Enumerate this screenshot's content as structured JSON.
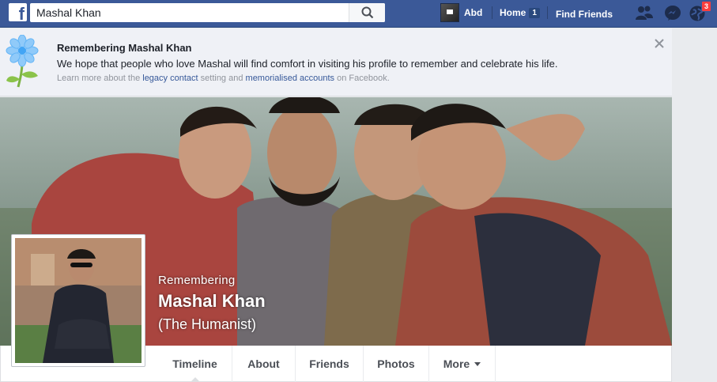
{
  "topbar": {
    "search_value": "Mashal Khan",
    "user_name": "Abd",
    "home_label": "Home",
    "home_count": "1",
    "find_friends_label": "Find Friends",
    "notifications_count": "3",
    "brand_color": "#3b5998"
  },
  "banner": {
    "title": "Remembering Mashal Khan",
    "text": "We hope that people who love Mashal will find comfort in visiting his profile to remember and celebrate his life.",
    "learn_prefix": "Learn more about the",
    "legacy_link": "legacy contact",
    "learn_middle": "setting and",
    "memorial_link": "memorialised accounts",
    "learn_suffix": "on Facebook."
  },
  "profile": {
    "remembering_label": "Remembering",
    "name": "Mashal Khan",
    "nickname": "(The Humanist)"
  },
  "tabs": [
    {
      "label": "Timeline",
      "active": true
    },
    {
      "label": "About"
    },
    {
      "label": "Friends"
    },
    {
      "label": "Photos"
    },
    {
      "label": "More"
    }
  ]
}
